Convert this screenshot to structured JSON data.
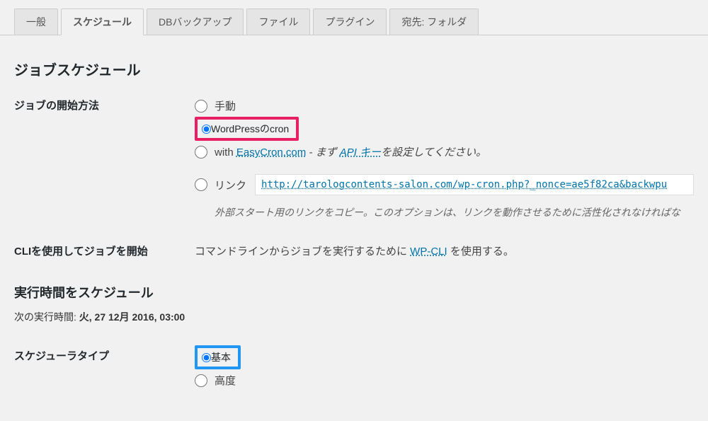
{
  "tabs": {
    "general": "一般",
    "schedule": "スケジュール",
    "db_backup": "DBバックアップ",
    "files": "ファイル",
    "plugins": "プラグイン",
    "destination": "宛先: フォルダ"
  },
  "headings": {
    "job_schedule": "ジョブスケジュール",
    "execution_time_schedule": "実行時間をスケジュール"
  },
  "labels": {
    "start_method": "ジョブの開始方法",
    "cli_start": "CLIを使用してジョブを開始",
    "scheduler_type": "スケジューラタイプ"
  },
  "start_options": {
    "manual": "手動",
    "wp_cron": "WordPressのcron",
    "easycron_prefix": "with ",
    "easycron_link": "EasyCron.com",
    "easycron_mid": " - まず ",
    "easycron_api": "API キー",
    "easycron_suffix": "を設定してください。",
    "link_label": "リンク",
    "link_url": "http://tarologcontents-salon.com/wp-cron.php?_nonce=ae5f82ca&backwpu",
    "link_hint": "外部スタート用のリンクをコピー。このオプションは、リンクを動作させるために活性化されなければな"
  },
  "cli": {
    "text_prefix": "コマンドラインからジョブを実行するために ",
    "link": "WP-CLI",
    "text_suffix": " を使用する。"
  },
  "next_run": {
    "label": "次の実行時間: ",
    "value": "火, 27 12月 2016, 03:00"
  },
  "scheduler_options": {
    "basic": "基本",
    "advanced": "高度"
  }
}
